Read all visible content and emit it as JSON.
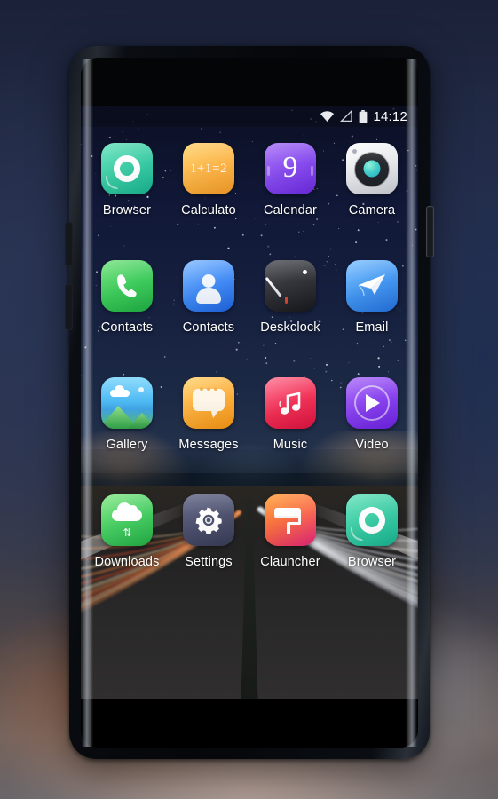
{
  "device": {
    "name": "android-smartphone-mockup",
    "hardware_buttons": [
      "volume-up",
      "volume-down",
      "power"
    ]
  },
  "statusbar": {
    "wifi_icon": "wifi-icon",
    "signal_icon": "signal-icon",
    "battery_icon": "battery-icon",
    "time": "14:12"
  },
  "wallpaper": {
    "description": "night highway with light trails under a starry sky"
  },
  "homescreen": {
    "rows": [
      [
        {
          "label": "Browser",
          "icon": "browser-icon"
        },
        {
          "label": "Calculato",
          "icon": "calculator-icon",
          "glyph": "1+1=2"
        },
        {
          "label": "Calendar",
          "icon": "calendar-icon",
          "glyph": "9"
        },
        {
          "label": "Camera",
          "icon": "camera-icon"
        }
      ],
      [
        {
          "label": "Contacts",
          "icon": "phone-icon"
        },
        {
          "label": "Contacts",
          "icon": "contacts-icon"
        },
        {
          "label": "Deskclock",
          "icon": "deskclock-icon"
        },
        {
          "label": "Email",
          "icon": "email-icon"
        }
      ],
      [
        {
          "label": "Gallery",
          "icon": "gallery-icon"
        },
        {
          "label": "Messages",
          "icon": "messages-icon"
        },
        {
          "label": "Music",
          "icon": "music-icon"
        },
        {
          "label": "Video",
          "icon": "video-icon"
        }
      ],
      [
        {
          "label": "Downloads",
          "icon": "downloads-icon",
          "glyph": "↑↓"
        },
        {
          "label": "Settings",
          "icon": "settings-icon"
        },
        {
          "label": "Clauncher",
          "icon": "clauncher-icon"
        },
        {
          "label": "Browser",
          "icon": "browser-icon"
        }
      ]
    ]
  },
  "colors": {
    "browser": "#32c9a0",
    "calculator": "#fbb03f",
    "calendar": "#8244ee",
    "camera": "#e6e8ec",
    "phone": "#36c955",
    "contacts": "#3a87f5",
    "deskclock": "#2a2c32",
    "email": "#3b92f0",
    "gallery": "#46b6f3",
    "messages": "#fcab33",
    "music": "#f0294f",
    "video": "#8339ee",
    "downloads": "#3fcb5c",
    "settings": "#464a68",
    "clauncher": "#fa6a3c",
    "label_text": "#ffffff",
    "statusbar_text": "#ffffff"
  }
}
